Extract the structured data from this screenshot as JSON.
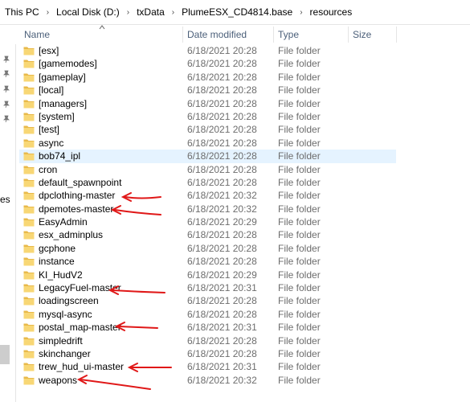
{
  "breadcrumb": [
    "This PC",
    "Local Disk (D:)",
    "txData",
    "PlumeESX_CD4814.base",
    "resources"
  ],
  "breadcrumb_separator": "›",
  "nav": {
    "partial_label": "es"
  },
  "columns": {
    "name": "Name",
    "date": "Date modified",
    "type": "Type",
    "size": "Size"
  },
  "colors": {
    "folder": "#f8d775",
    "folder_dark": "#e8b94a",
    "hover": "#e5f3ff",
    "annotation": "#e01818",
    "header_text": "#4c607a"
  },
  "rows": [
    {
      "name": "[esx]",
      "date": "6/18/2021 20:28",
      "type": "File folder"
    },
    {
      "name": "[gamemodes]",
      "date": "6/18/2021 20:28",
      "type": "File folder"
    },
    {
      "name": "[gameplay]",
      "date": "6/18/2021 20:28",
      "type": "File folder"
    },
    {
      "name": "[local]",
      "date": "6/18/2021 20:28",
      "type": "File folder"
    },
    {
      "name": "[managers]",
      "date": "6/18/2021 20:28",
      "type": "File folder"
    },
    {
      "name": "[system]",
      "date": "6/18/2021 20:28",
      "type": "File folder"
    },
    {
      "name": "[test]",
      "date": "6/18/2021 20:28",
      "type": "File folder"
    },
    {
      "name": "async",
      "date": "6/18/2021 20:28",
      "type": "File folder"
    },
    {
      "name": "bob74_ipl",
      "date": "6/18/2021 20:28",
      "type": "File folder"
    },
    {
      "name": "cron",
      "date": "6/18/2021 20:28",
      "type": "File folder"
    },
    {
      "name": "default_spawnpoint",
      "date": "6/18/2021 20:28",
      "type": "File folder"
    },
    {
      "name": "dpclothing-master",
      "date": "6/18/2021 20:32",
      "type": "File folder"
    },
    {
      "name": "dpemotes-master",
      "date": "6/18/2021 20:32",
      "type": "File folder"
    },
    {
      "name": "EasyAdmin",
      "date": "6/18/2021 20:29",
      "type": "File folder"
    },
    {
      "name": "esx_adminplus",
      "date": "6/18/2021 20:28",
      "type": "File folder"
    },
    {
      "name": "gcphone",
      "date": "6/18/2021 20:28",
      "type": "File folder"
    },
    {
      "name": "instance",
      "date": "6/18/2021 20:28",
      "type": "File folder"
    },
    {
      "name": "KI_HudV2",
      "date": "6/18/2021 20:29",
      "type": "File folder"
    },
    {
      "name": "LegacyFuel-master",
      "date": "6/18/2021 20:31",
      "type": "File folder"
    },
    {
      "name": "loadingscreen",
      "date": "6/18/2021 20:28",
      "type": "File folder"
    },
    {
      "name": "mysql-async",
      "date": "6/18/2021 20:28",
      "type": "File folder"
    },
    {
      "name": "postal_map-master",
      "date": "6/18/2021 20:31",
      "type": "File folder"
    },
    {
      "name": "simpledrift",
      "date": "6/18/2021 20:28",
      "type": "File folder"
    },
    {
      "name": "skinchanger",
      "date": "6/18/2021 20:28",
      "type": "File folder"
    },
    {
      "name": "trew_hud_ui-master",
      "date": "6/18/2021 20:31",
      "type": "File folder"
    },
    {
      "name": "weapons",
      "date": "6/18/2021 20:32",
      "type": "File folder"
    }
  ],
  "hovered_row": "bob74_ipl",
  "annotated_rows": [
    "dpclothing-master",
    "dpemotes-master",
    "LegacyFuel-master",
    "postal_map-master",
    "trew_hud_ui-master",
    "weapons"
  ]
}
